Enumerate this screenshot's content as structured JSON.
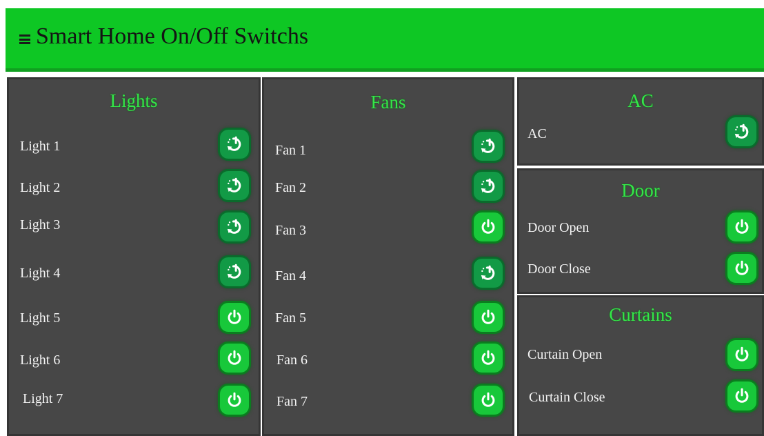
{
  "header": {
    "title": "Smart Home On/Off Switchs"
  },
  "icons": {
    "menu": "hamburger-icon",
    "power": "power-icon",
    "refresh_power": "power-refresh-icon"
  },
  "colors": {
    "header_bg": "#0ec724",
    "panel_bg": "#474747",
    "accent_green": "#35e649",
    "button_on": "#18c83a",
    "button_dark": "#129a46"
  },
  "panels": {
    "lights": {
      "title": "Lights",
      "items": [
        {
          "label": "Light 1"
        },
        {
          "label": "Light 2"
        },
        {
          "label": "Light 3"
        },
        {
          "label": "Light 4"
        },
        {
          "label": "Light 5"
        },
        {
          "label": "Light 6"
        },
        {
          "label": "Light 7"
        }
      ]
    },
    "fans": {
      "title": "Fans",
      "items": [
        {
          "label": "Fan 1"
        },
        {
          "label": "Fan 2"
        },
        {
          "label": "Fan 3"
        },
        {
          "label": "Fan 4"
        },
        {
          "label": "Fan 5"
        },
        {
          "label": "Fan 6"
        },
        {
          "label": "Fan 7"
        }
      ]
    },
    "ac": {
      "title": "AC",
      "items": [
        {
          "label": "AC"
        }
      ]
    },
    "door": {
      "title": "Door",
      "items": [
        {
          "label": "Door Open"
        },
        {
          "label": "Door Close"
        }
      ]
    },
    "curtains": {
      "title": "Curtains",
      "items": [
        {
          "label": "Curtain Open"
        },
        {
          "label": "Curtain Close"
        }
      ]
    }
  }
}
